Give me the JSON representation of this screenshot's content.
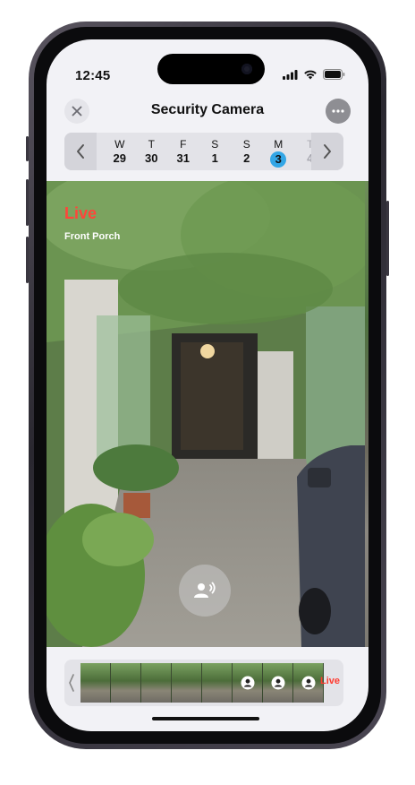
{
  "status": {
    "time": "12:45"
  },
  "nav": {
    "title": "Security Camera",
    "close_icon": "close-icon",
    "more_icon": "more-icon"
  },
  "days": [
    {
      "name": "W",
      "date": "29",
      "state": "normal"
    },
    {
      "name": "T",
      "date": "30",
      "state": "normal"
    },
    {
      "name": "F",
      "date": "31",
      "state": "normal"
    },
    {
      "name": "S",
      "date": "1",
      "state": "normal"
    },
    {
      "name": "S",
      "date": "2",
      "state": "normal"
    },
    {
      "name": "M",
      "date": "3",
      "state": "selected"
    },
    {
      "name": "T",
      "date": "4",
      "state": "future"
    }
  ],
  "video": {
    "live_label": "Live",
    "camera_name": "Front Porch",
    "talk_icon": "intercom-icon"
  },
  "timeline": {
    "thumbs": [
      "clip",
      "clip",
      "clip",
      "clip",
      "clip",
      "person",
      "person",
      "person"
    ],
    "live_label": "Live"
  },
  "colors": {
    "accent": "#33a6e6",
    "live": "#ff453a"
  }
}
